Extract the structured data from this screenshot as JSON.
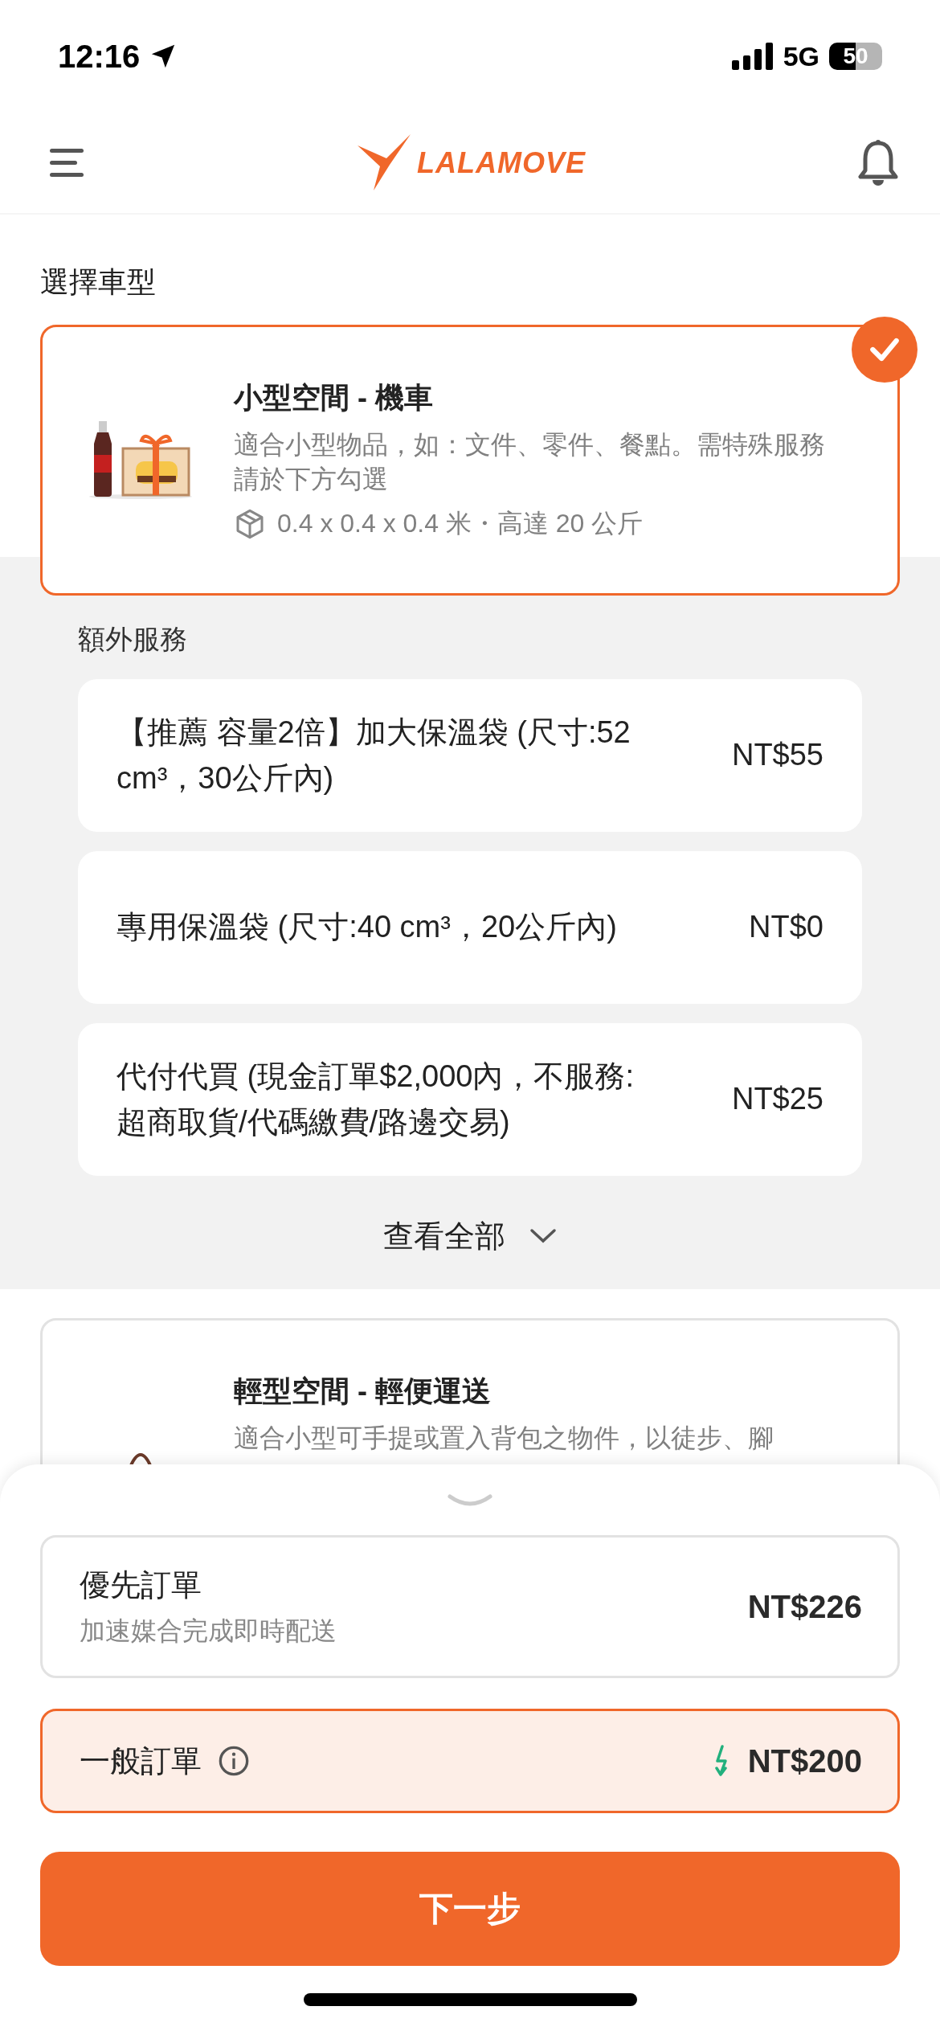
{
  "status_bar": {
    "time": "12:16",
    "network": "5G",
    "battery": "50"
  },
  "header": {
    "logo": "LALAMOVE"
  },
  "section_title": "選擇車型",
  "vehicles": [
    {
      "title": "小型空間 - 機車",
      "description": "適合小型物品，如：文件、零件、餐點。需特殊服務請於下方勾選",
      "size": "0.4 x 0.4 x 0.4 米・高達 20 公斤",
      "selected": true
    },
    {
      "title": "輕型空間 - 輕便運送",
      "description": "適合小型可手提或置入背包之物件，以徒步、腳",
      "selected": false
    }
  ],
  "extra_services": {
    "title": "額外服務",
    "items": [
      {
        "name": "【推薦 容量2倍】加大保溫袋 (尺寸:52 cm³，30公斤內)",
        "price": "NT$55"
      },
      {
        "name": "專用保溫袋 (尺寸:40 cm³，20公斤內)",
        "price": "NT$0"
      },
      {
        "name": "代付代買 (現金訂單$2,000內，不服務: 超商取貨/代碼繳費/路邊交易)",
        "price": "NT$25"
      }
    ],
    "view_all": "查看全部"
  },
  "order_options": [
    {
      "kind": "priority",
      "title": "優先訂單",
      "subtitle": "加速媒合完成即時配送",
      "price": "NT$226",
      "selected": false
    },
    {
      "kind": "standard",
      "title": "一般訂單",
      "price": "NT$200",
      "selected": true
    }
  ],
  "next_button": "下一步"
}
